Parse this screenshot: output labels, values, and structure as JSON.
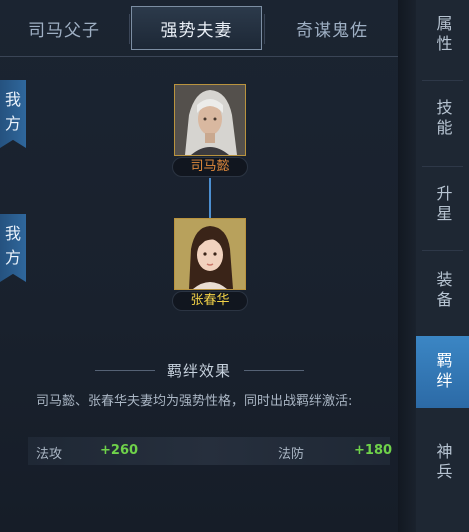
{
  "tabs": [
    {
      "label": "司马父子"
    },
    {
      "label": "强势夫妻",
      "active": true
    },
    {
      "label": "奇谋鬼佐"
    }
  ],
  "side_tags": [
    {
      "label": "我方"
    },
    {
      "label": "我方"
    }
  ],
  "heroes": [
    {
      "name": "司马懿",
      "name_color": "#e08a3c",
      "icon": "hero-portrait-male-icon"
    },
    {
      "name": "张春华",
      "name_color": "#f2d247",
      "icon": "hero-portrait-female-icon"
    }
  ],
  "effect": {
    "title": "羁绊效果",
    "description": "司马懿、张春华夫妻均为强势性格，同时出战羁绊激活:",
    "stats": [
      {
        "label": "法攻",
        "value": "+260"
      },
      {
        "label": "法防",
        "value": "+180"
      }
    ]
  },
  "right_nav": [
    {
      "label": "属性"
    },
    {
      "label": "技能"
    },
    {
      "label": "升星"
    },
    {
      "label": "装备"
    },
    {
      "label": "羁绊",
      "active": true
    },
    {
      "label": "神兵"
    }
  ],
  "colors": {
    "accent": "#2f79b8",
    "value_green": "#6fd24a",
    "portrait_border": "#b9933e"
  }
}
